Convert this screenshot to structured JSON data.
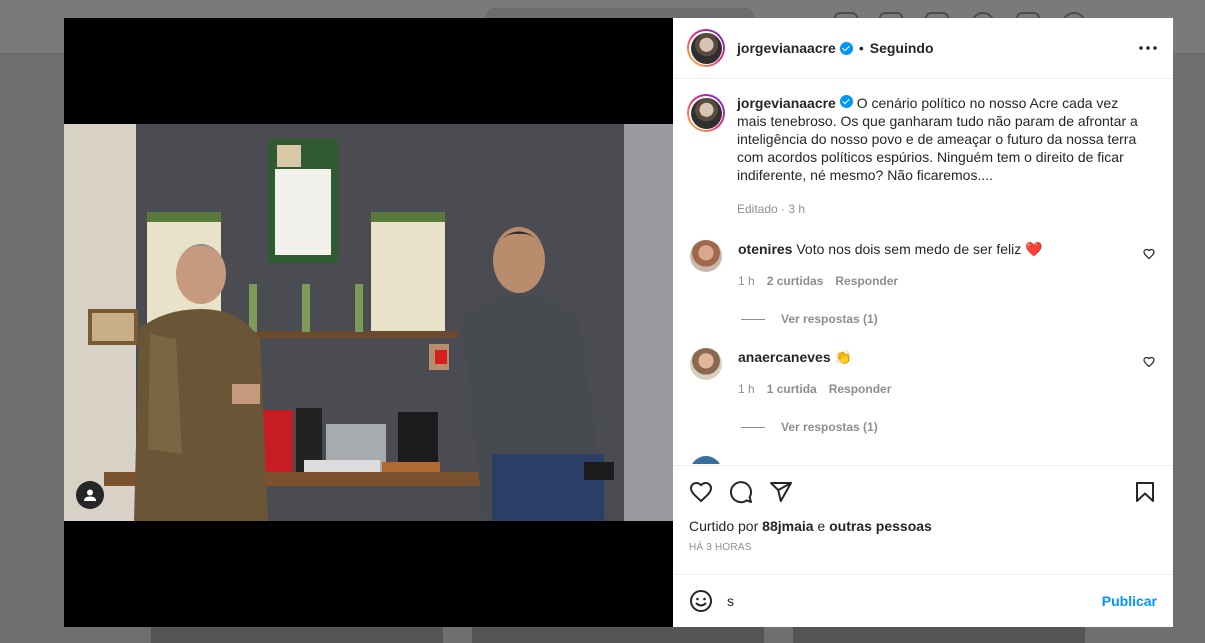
{
  "post": {
    "username": "jorgevianaacre",
    "follow_status": "Seguindo",
    "separator": "•",
    "caption": "O cenário político no nosso Acre cada vez mais tenebroso. Os que ganharam tudo não param de afrontar a inteligência do nosso povo e de ameaçar o futuro da nossa terra com acordos políticos espúrios. Ninguém tem o direito de ficar indiferente, né mesmo? Não ficaremos....",
    "caption_meta": "Editado · 3 h",
    "likes_prefix": "Curtido por",
    "likes_user": "88jmaia",
    "likes_connector": "e",
    "likes_suffix": "outras pessoas",
    "timestamp": "HÁ 3 HORAS"
  },
  "comments": [
    {
      "username": "otenires",
      "text": "Voto nos dois sem medo de ser feliz",
      "emoji": "❤️",
      "time": "1 h",
      "likes": "2 curtidas",
      "reply": "Responder",
      "view_replies": "Ver respostas (1)"
    },
    {
      "username": "anaercaneves",
      "text": "",
      "emoji": "👏",
      "time": "1 h",
      "likes": "1 curtida",
      "reply": "Responder",
      "view_replies": "Ver respostas (1)"
    }
  ],
  "composer": {
    "value": "s",
    "publish_label": "Publicar"
  },
  "icons": {
    "more": "more-options-icon",
    "like": "heart-icon",
    "comment": "comment-icon",
    "share": "share-icon",
    "save": "bookmark-icon",
    "emoji": "emoji-icon",
    "tag": "user-tag-icon"
  },
  "colors": {
    "accent": "#0095f6",
    "verified": "#0095f6",
    "secondary_text": "#8e8e8e",
    "primary_text": "#262626"
  }
}
